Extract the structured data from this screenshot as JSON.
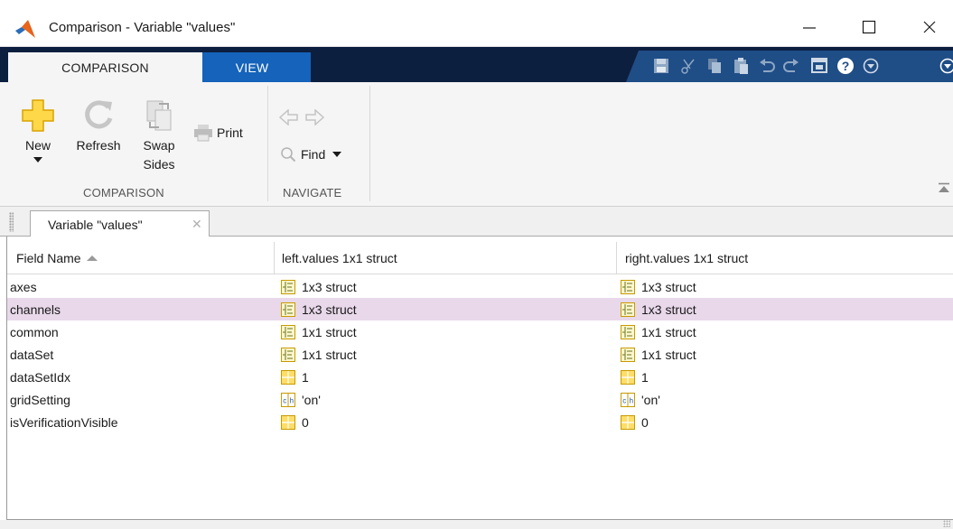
{
  "window": {
    "title": "Comparison - Variable \"values\"",
    "app_icon": "matlab-logo-icon",
    "controls": [
      "minimize-icon",
      "maximize-icon",
      "close-icon"
    ]
  },
  "ribbon_tabs": [
    {
      "label": "COMPARISON",
      "active": true
    },
    {
      "label": "VIEW",
      "active": false
    }
  ],
  "quick_access_icons": [
    "save-icon",
    "cut-icon",
    "copy-icon",
    "paste-icon",
    "undo-icon",
    "redo-icon",
    "switch-windows-icon",
    "help-icon",
    "options-icon",
    "expand-icon"
  ],
  "ribbon": {
    "comparison_section": {
      "label": "COMPARISON",
      "new_label": "New",
      "refresh_label": "Refresh",
      "swap_label_1": "Swap",
      "swap_label_2": "Sides",
      "print_label": "Print"
    },
    "navigate_section": {
      "label": "NAVIGATE",
      "find_label": "Find"
    }
  },
  "document_tab": {
    "label": "Variable \"values\"",
    "close_icon": "close-tab-icon"
  },
  "table": {
    "columns": [
      "Field Name",
      "left.values 1x1 struct",
      "right.values 1x1 struct"
    ],
    "sort_column": 0,
    "sort_direction": "ascending",
    "selected_row": 1,
    "rows": [
      {
        "field": "axes",
        "left_icon": "struct-icon",
        "left": "1x3 struct",
        "right_icon": "struct-icon",
        "right": "1x3 struct"
      },
      {
        "field": "channels",
        "left_icon": "struct-icon",
        "left": "1x3 struct",
        "right_icon": "struct-icon",
        "right": "1x3 struct"
      },
      {
        "field": "common",
        "left_icon": "struct-icon",
        "left": "1x1 struct",
        "right_icon": "struct-icon",
        "right": "1x1 struct"
      },
      {
        "field": "dataSet",
        "left_icon": "struct-icon",
        "left": "1x1 struct",
        "right_icon": "struct-icon",
        "right": "1x1 struct"
      },
      {
        "field": "dataSetIdx",
        "left_icon": "numeric-icon",
        "left": "1",
        "right_icon": "numeric-icon",
        "right": "1"
      },
      {
        "field": "gridSetting",
        "left_icon": "char-icon",
        "left": "'on'",
        "right_icon": "char-icon",
        "right": "'on'"
      },
      {
        "field": "isVerificationVisible",
        "left_icon": "numeric-icon",
        "left": "0",
        "right_icon": "numeric-icon",
        "right": "0"
      }
    ]
  },
  "colors": {
    "tabstrip_bg": "#0d1f3f",
    "view_tab_bg": "#1563ba",
    "ribbon_bg": "#f5f5f5",
    "selected_row_bg": "#e8d8ea"
  }
}
